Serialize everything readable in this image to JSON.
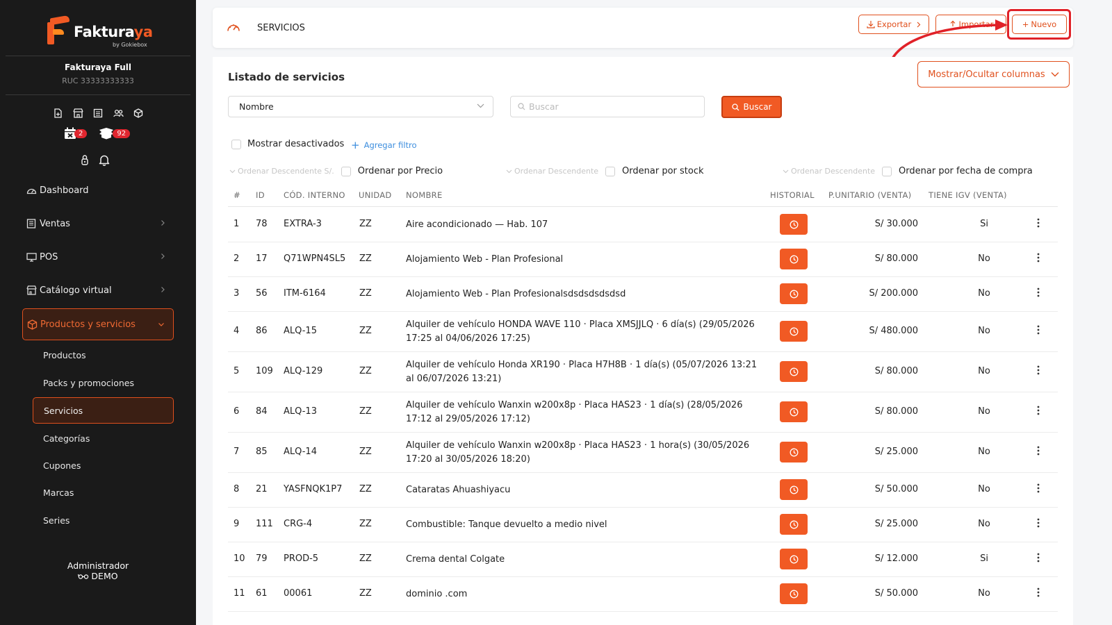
{
  "sidebar": {
    "brand_main": "Faktura",
    "brand_accent": "ya",
    "brand_sub": "by Gokiebox",
    "company": "Fakturaya Full",
    "ruc": "RUC 33333333333",
    "badge_calendar": "2",
    "badge_box": "92",
    "nav": [
      {
        "label": "Dashboard",
        "icon": "gauge-icon"
      },
      {
        "label": "Ventas",
        "icon": "receipt-icon"
      },
      {
        "label": "POS",
        "icon": "monitor-icon"
      },
      {
        "label": "Catálogo virtual",
        "icon": "store-icon"
      },
      {
        "label": "Productos y servicios",
        "icon": "box-icon"
      }
    ],
    "sub": [
      {
        "label": "Productos"
      },
      {
        "label": "Packs y promociones"
      },
      {
        "label": "Servicios"
      },
      {
        "label": "Categorías"
      },
      {
        "label": "Cupones"
      },
      {
        "label": "Marcas"
      },
      {
        "label": "Series"
      }
    ],
    "user_role": "Administrador",
    "user_name": "DEMO"
  },
  "header": {
    "title": "SERVICIOS",
    "export_label": "Exportar",
    "import_label": "Importar",
    "new_label": "Nuevo"
  },
  "main": {
    "list_title": "Listado de servicios",
    "columns_button": "Mostrar/Ocultar columnas",
    "filter_select": "Nombre",
    "search_placeholder": "Buscar",
    "search_button": "Buscar",
    "show_disabled": "Mostrar desactivados",
    "add_filter": "Agregar filtro",
    "order": [
      {
        "desc": "Ordenar Descendente S/.",
        "label": "Ordenar por Precio"
      },
      {
        "desc": "Ordenar Descendente",
        "label": "Ordenar por stock"
      },
      {
        "desc": "Ordenar Descendente",
        "label": "Ordenar por fecha de compra"
      }
    ]
  },
  "table": {
    "headers": {
      "num": "#",
      "id": "ID",
      "code": "CÓD. INTERNO",
      "unit": "UNIDAD",
      "name": "NOMBRE",
      "history": "HISTORIAL",
      "price": "P.UNITARIO (VENTA)",
      "igv": "TIENE IGV (VENTA)"
    },
    "rows": [
      {
        "num": "1",
        "id": "78",
        "code": "EXTRA-3",
        "unit": "ZZ",
        "name": "Aire acondicionado — Hab. 107",
        "price": "S/ 30.000",
        "igv": "Si"
      },
      {
        "num": "2",
        "id": "17",
        "code": "Q71WPN4SL5",
        "unit": "ZZ",
        "name": "Alojamiento Web - Plan Profesional",
        "price": "S/ 80.000",
        "igv": "No"
      },
      {
        "num": "3",
        "id": "56",
        "code": "ITM-6164",
        "unit": "ZZ",
        "name": "Alojamiento Web - Plan Profesionalsdsdsdsdsdsd",
        "price": "S/ 200.000",
        "igv": "No"
      },
      {
        "num": "4",
        "id": "86",
        "code": "ALQ-15",
        "unit": "ZZ",
        "name": "Alquiler de vehículo HONDA WAVE 110 · Placa XMSJJLQ · 6 día(s) (29/05/2026 17:25 al 04/06/2026 17:25)",
        "price": "S/ 480.000",
        "igv": "No"
      },
      {
        "num": "5",
        "id": "109",
        "code": "ALQ-129",
        "unit": "ZZ",
        "name": "Alquiler de vehículo Honda XR190 · Placa H7H8B · 1 día(s) (05/07/2026 13:21 al 06/07/2026 13:21)",
        "price": "S/ 80.000",
        "igv": "No"
      },
      {
        "num": "6",
        "id": "84",
        "code": "ALQ-13",
        "unit": "ZZ",
        "name": "Alquiler de vehículo Wanxin w200x8p · Placa HAS23 · 1 día(s) (28/05/2026 17:12 al 29/05/2026 17:12)",
        "price": "S/ 80.000",
        "igv": "No"
      },
      {
        "num": "7",
        "id": "85",
        "code": "ALQ-14",
        "unit": "ZZ",
        "name": "Alquiler de vehículo Wanxin w200x8p · Placa HAS23 · 1 hora(s) (30/05/2026 17:20 al 30/05/2026 18:20)",
        "price": "S/ 25.000",
        "igv": "No"
      },
      {
        "num": "8",
        "id": "21",
        "code": "YASFNQK1P7",
        "unit": "ZZ",
        "name": "Cataratas Ahuashiyacu",
        "price": "S/ 50.000",
        "igv": "No"
      },
      {
        "num": "9",
        "id": "111",
        "code": "CRG-4",
        "unit": "ZZ",
        "name": "Combustible: Tanque devuelto a medio nivel",
        "price": "S/ 25.000",
        "igv": "No"
      },
      {
        "num": "10",
        "id": "79",
        "code": "PROD-5",
        "unit": "ZZ",
        "name": "Crema dental Colgate",
        "price": "S/ 12.000",
        "igv": "Si"
      },
      {
        "num": "11",
        "id": "61",
        "code": "00061",
        "unit": "ZZ",
        "name": "dominio .com",
        "price": "S/ 50.000",
        "igv": "No"
      }
    ]
  },
  "colors": {
    "accent": "#f15a24",
    "sidebar_bg": "#1a1a1a",
    "highlight": "#e02128"
  }
}
